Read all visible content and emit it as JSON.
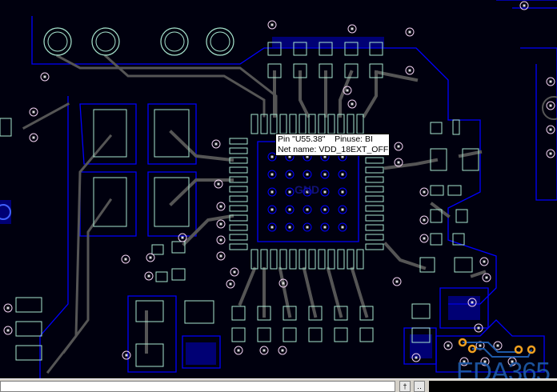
{
  "tooltip": {
    "line1": "Pin \"U55.38\"    Pinuse: BI",
    "line2": "Net name: VDD_18EXT_OFF"
  },
  "board": {
    "thermal_pad_label": "GND"
  },
  "watermark": "EDA365",
  "bottom_bar": {
    "command_value": "",
    "button1_label": "†",
    "button2_label": "‥"
  },
  "colors": {
    "background": "#00000e",
    "pad_outline": "#a8e6cf",
    "trace": "#555555",
    "copper": "#0000ff",
    "highlight_via": "#f0a020",
    "highlight_trace": "#1e5aa8"
  }
}
